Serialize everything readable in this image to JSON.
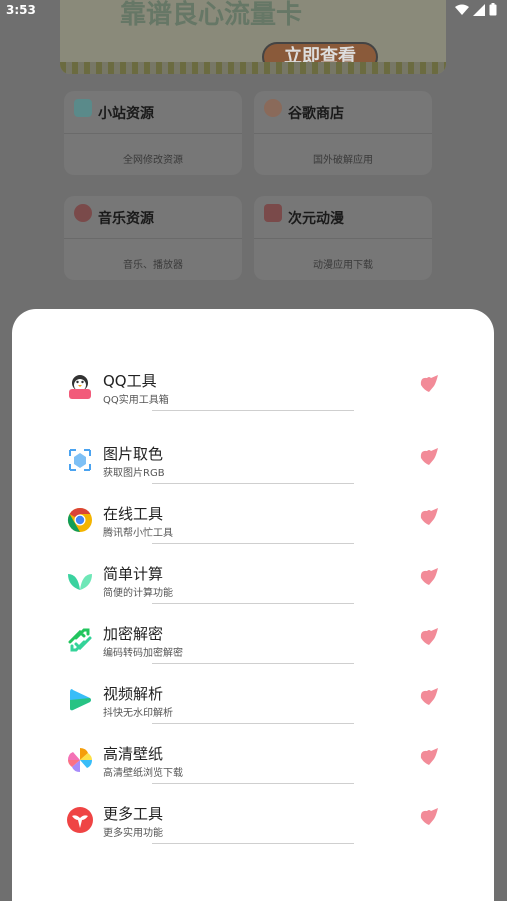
{
  "status": {
    "time": "3:53"
  },
  "background": {
    "banner": {
      "headline": "靠谱良心流量卡",
      "cta": "立即查看"
    },
    "cards": [
      {
        "title": "小站资源",
        "subtitle": "全网修改资源",
        "icon": "play-icon",
        "color": "#5a8a8a"
      },
      {
        "title": "谷歌商店",
        "subtitle": "国外破解应用",
        "icon": "google-icon",
        "color": "#8a6a5a"
      },
      {
        "title": "音乐资源",
        "subtitle": "音乐、播放器",
        "icon": "music-icon",
        "color": "#7a4a4a"
      },
      {
        "title": "次元动漫",
        "subtitle": "动漫应用下载",
        "icon": "anime-icon",
        "color": "#7a4a4a"
      }
    ]
  },
  "tools": [
    {
      "title": "QQ工具",
      "subtitle": "QQ实用工具箱",
      "icon": "qq-penguin-icon"
    },
    {
      "title": "图片取色",
      "subtitle": "获取图片RGB",
      "icon": "color-picker-icon"
    },
    {
      "title": "在线工具",
      "subtitle": "腾讯帮小忙工具",
      "icon": "chrome-icon"
    },
    {
      "title": "简单计算",
      "subtitle": "简便的计算功能",
      "icon": "leaf-icon"
    },
    {
      "title": "加密解密",
      "subtitle": "编码转码加密解密",
      "icon": "swap-arrows-icon"
    },
    {
      "title": "视频解析",
      "subtitle": "抖快无水印解析",
      "icon": "video-play-icon"
    },
    {
      "title": "高清壁纸",
      "subtitle": "高清壁纸浏览下载",
      "icon": "pinwheel-icon"
    },
    {
      "title": "更多工具",
      "subtitle": "更多实用功能",
      "icon": "bird-icon"
    }
  ],
  "colors": {
    "accent_heart": "#f28b98"
  }
}
